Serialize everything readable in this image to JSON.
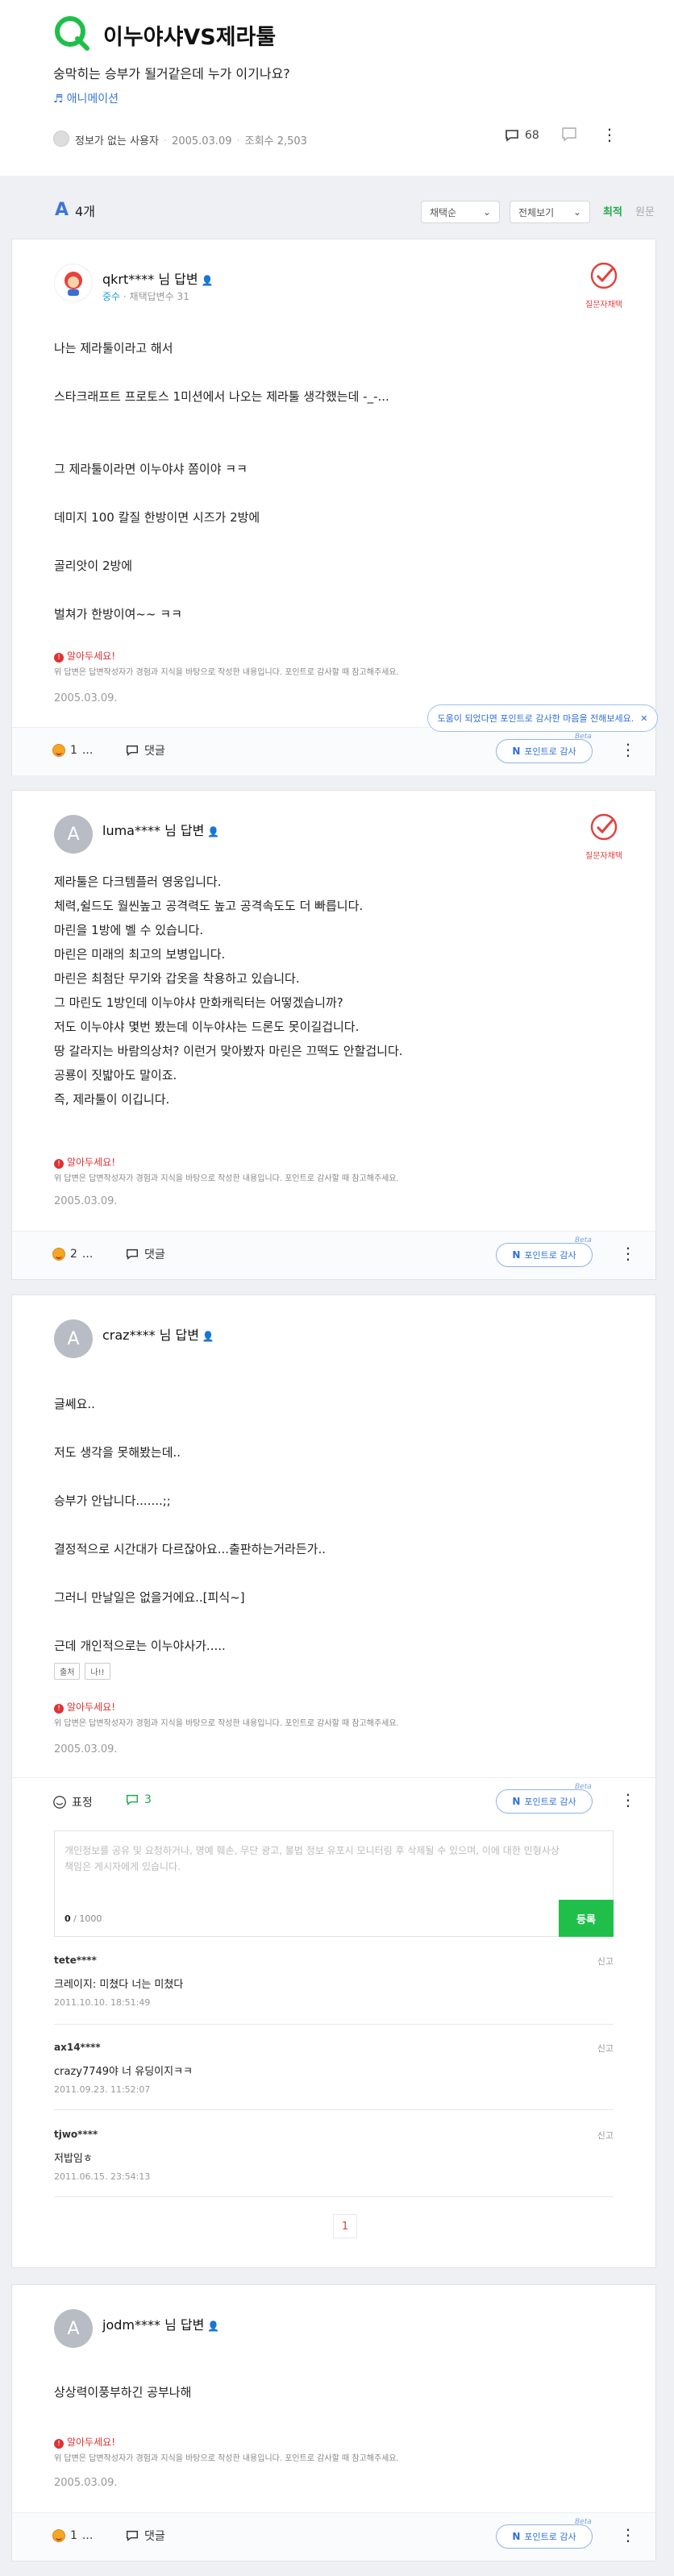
{
  "question": {
    "title": "이누야샤VS제라툴",
    "body": "숭막히는 승부가 될거같은데 누가 이기나요?",
    "category": "애니메이션",
    "author": "정보가 없는 사용자",
    "date": "2005.03.09",
    "views_label": "조회수",
    "views": "2,503",
    "comments": "68"
  },
  "answers_bar": {
    "count": "4개",
    "sort_select": "채택순",
    "filter_select": "전체보기",
    "sort_best": "최적",
    "sort_new": "원문"
  },
  "tooltip": "도움이 되었다면 포인트로 감사한 마음을 전해보세요.",
  "badge_label": "질문자채택",
  "thank_label": "포인트로 감사",
  "beta": "Beta",
  "reply_label": "댓글",
  "react_label": "표정",
  "notice": {
    "title": "알아두세요!",
    "text": "위 답변은 답변작성자가 경험과 지식을 바탕으로 작성한 내용입니다. 포인트로 감사할 때 참고해주세요."
  },
  "answers": [
    {
      "avatar": "",
      "user": "qkrt**** 님 답변",
      "level": "중수",
      "sub": "채택답변수 31",
      "text": "나는 제라툴이라고 해서\n\n스타크래프트 프로토스 1미션에서 나오는 제라툴 생각했는데 -_-...\n\n\n그 제라툴이라면 이누야샤 쫌이야 ㅋㅋ\n\n데미지 100 칼질 한방이면 시즈가 2방에\n\n골리앗이 2방에\n\n벌쳐가 한방이여~~ ㅋㅋ",
      "date": "2005.03.09.",
      "reactions": "1",
      "reply_count": "..."
    },
    {
      "avatar": "A",
      "user": "luma**** 님 답변",
      "text": "제라툴은 다크템플러 영웅입니다.\n체력,쉴드도 월씬높고 공격력도 높고 공격속도도 더 빠릅니다.\n마린을 1방에 벨 수 있습니다.\n마린은 미래의 최고의 보병입니다.\n마린은 최첨단 무기와 갑옷을 착용하고 있습니다.\n그 마린도 1방인데 이누야샤 만화캐릭터는 어떻겠습니까?\n저도 이누야샤 몇번 봤는데 이누야샤는 드론도 못이길겁니다.\n땅 갈라지는 바람의상처? 이런거 맞아봤자 마린은 끄떡도 안할겁니다.\n공룡이 짓밟아도 말이죠.\n즉, 제라툴이 이깁니다.",
      "date": "2005.03.09.",
      "reactions": "2",
      "reply_count": "..."
    },
    {
      "avatar": "A",
      "user": "craz**** 님 답변",
      "text": "글쎄요..\n\n저도 생각을 못해봤는데..\n\n승부가 안납니다.......;;\n\n결정적으로 시간대가 다르잖아요...출판하는거라든가..\n\n그러니 만날일은 없을거에요..[피식~]\n\n근데 개인적으로는 이누야사가.....",
      "tags": [
        "출처",
        "나!!"
      ],
      "date": "2005.03.09.",
      "reply_count": "3",
      "comment_placeholder": "개인정보를 공유 및 요청하거나, 명예 훼손, 무단 광고, 불법 정보 유포시 모니터링 후 삭제될 수 있으며, 이에 대한 민형사상 책임은 게시자에게 있습니다.",
      "char_count": "0",
      "char_max": "/ 1000",
      "register": "등록",
      "comments": [
        {
          "user": "tete****",
          "text": "크레이지: 미쳤다 너는 미쳤다",
          "date": "2011.10.10. 18:51:49",
          "report": "신고"
        },
        {
          "user": "ax14****",
          "text": "crazy7749야 너 유딩이지ㅋㅋ",
          "date": "2011.09.23. 11:52:07",
          "report": "신고"
        },
        {
          "user": "tjwo****",
          "text": "저밥임ㅎ",
          "date": "2011.06.15. 23:54:13",
          "report": "신고"
        }
      ],
      "page": "1"
    },
    {
      "avatar": "A",
      "user": "jodm**** 님 답변",
      "text": "상상력이풍부하긴 공부나해",
      "date": "2005.03.09.",
      "reactions": "1",
      "reply_count": "..."
    }
  ]
}
